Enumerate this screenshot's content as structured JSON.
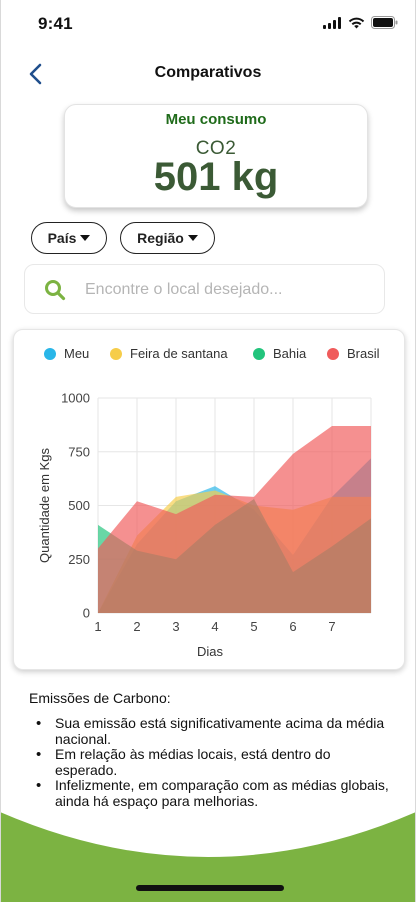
{
  "status_bar": {
    "time": "9:41"
  },
  "header": {
    "title": "Comparativos",
    "back_icon": "chevron-left-icon"
  },
  "consumption": {
    "title": "Meu consumo",
    "unit": "CO2",
    "value": "501 kg"
  },
  "filters": {
    "country_label": "País",
    "region_label": "Região"
  },
  "search": {
    "placeholder": "Encontre o local desejado...",
    "value": ""
  },
  "chart_data": {
    "type": "area",
    "title": "",
    "xlabel": "Dias",
    "ylabel": "Quantidade em Kgs",
    "x_ticks": [
      "1",
      "2",
      "3",
      "4",
      "5",
      "6",
      "7"
    ],
    "y_ticks": [
      "0",
      "250",
      "500",
      "750",
      "1000"
    ],
    "ylim": [
      0,
      1000
    ],
    "grid": true,
    "legend_position": "top",
    "series": [
      {
        "name": "Meu",
        "color": "#29b6e8",
        "x": [
          1,
          2,
          3,
          4,
          5,
          6,
          7,
          8
        ],
        "values": [
          0,
          320,
          520,
          590,
          480,
          270,
          540,
          720
        ]
      },
      {
        "name": "Feira de santana",
        "color": "#f6cd4a",
        "x": [
          1,
          2,
          3,
          4,
          5,
          6,
          7,
          8
        ],
        "values": [
          0,
          360,
          540,
          570,
          500,
          480,
          540,
          540
        ]
      },
      {
        "name": "Bahia",
        "color": "#22c47c",
        "x": [
          1,
          2,
          3,
          4,
          5,
          6,
          7,
          8
        ],
        "values": [
          410,
          290,
          250,
          410,
          530,
          190,
          310,
          440
        ]
      },
      {
        "name": "Brasil",
        "color": "#f05b5b",
        "x": [
          1,
          2,
          3,
          4,
          5,
          6,
          7,
          8
        ],
        "values": [
          300,
          520,
          460,
          550,
          540,
          740,
          870,
          870
        ]
      }
    ]
  },
  "notes": {
    "title": "Emissões de Carbono:",
    "items": [
      "Sua emissão está significativamente acima da média nacional.",
      "Em relação às médias locais, está dentro do esperado.",
      "Infelizmente, em comparação com as médias globais, ainda há espaço para melhorias."
    ]
  },
  "colors": {
    "accent_green": "#7cb342",
    "title_green": "#1f6b1a",
    "value_green": "#3b5a35",
    "back_blue": "#1f4e8c"
  }
}
